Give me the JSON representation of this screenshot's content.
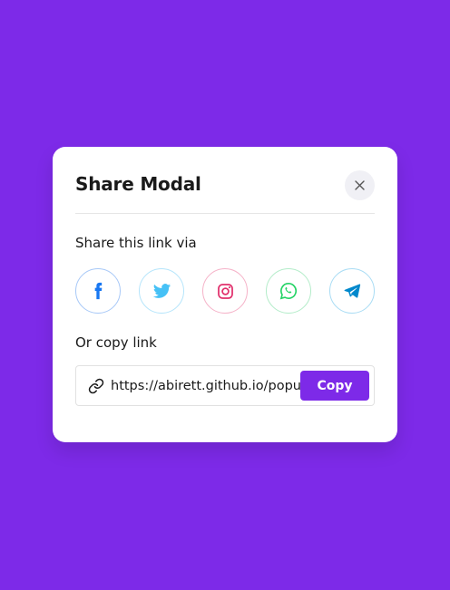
{
  "colors": {
    "background": "#7d2ae8",
    "accent": "#7d2ae8",
    "facebook": "#1877f2",
    "twitter": "#46c1f6",
    "instagram": "#e1306c",
    "whatsapp": "#25d366",
    "telegram": "#0088cc"
  },
  "modal": {
    "title": "Share Modal",
    "close_icon": "close-icon",
    "share_label": "Share this link via",
    "copy_label": "Or copy link",
    "social": [
      {
        "name": "facebook",
        "icon": "facebook-icon"
      },
      {
        "name": "twitter",
        "icon": "twitter-icon"
      },
      {
        "name": "instagram",
        "icon": "instagram-icon"
      },
      {
        "name": "whatsapp",
        "icon": "whatsapp-icon"
      },
      {
        "name": "telegram",
        "icon": "telegram-icon"
      }
    ],
    "link": {
      "icon": "link-icon",
      "value": "https://abirett.github.io/popup-share-modal/",
      "copy_button": "Copy"
    }
  }
}
